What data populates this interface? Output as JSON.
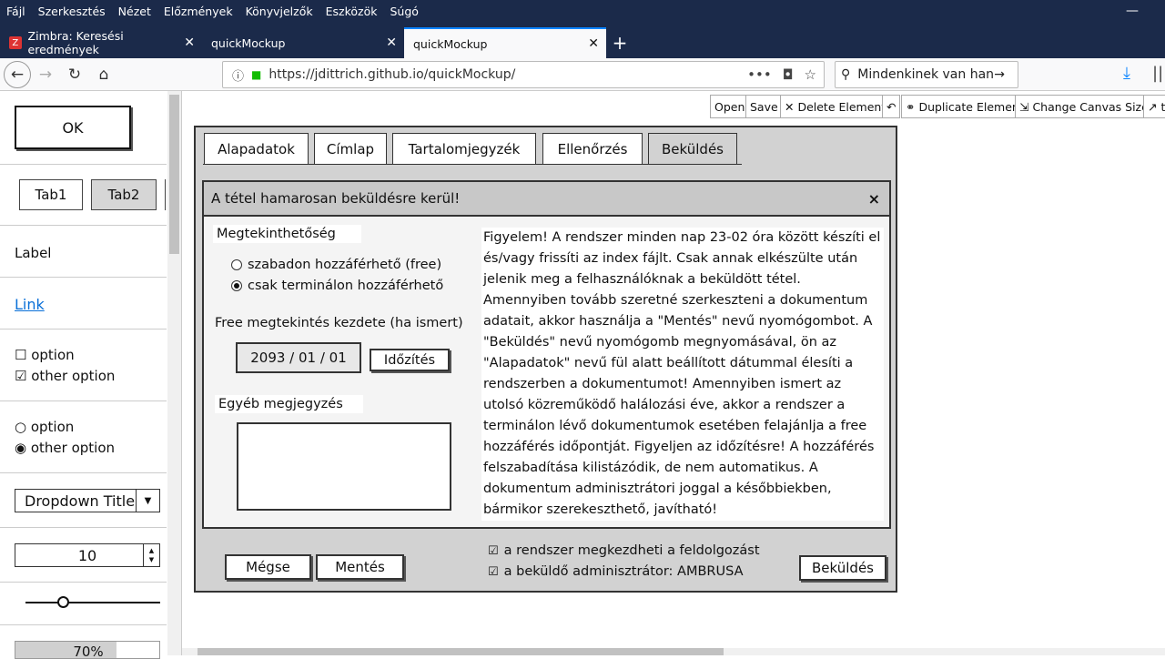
{
  "menubar": {
    "items": [
      "Fájl",
      "Szerkesztés",
      "Nézet",
      "Előzmények",
      "Könyvjelzők",
      "Eszközök",
      "Súgó"
    ],
    "minimize": "—"
  },
  "browser_tabs": [
    {
      "label": "Zimbra: Keresési eredmények",
      "favicon": "Z"
    },
    {
      "label": "quickMockup"
    },
    {
      "label": "quickMockup"
    }
  ],
  "new_tab": "+",
  "nav": {
    "back": "←",
    "forward": "→",
    "reload": "↻",
    "home": "⌂",
    "info": "ⓘ",
    "lock": "🔒",
    "url": "https://jdittrich.github.io/quickMockup/",
    "more": "•••",
    "pocket": "◘",
    "star": "☆",
    "search_icon": "⚲",
    "search_value": "Mindenkinek van hangj",
    "search_go": "→",
    "download": "⤓",
    "library": "|||\\"
  },
  "sidebar": {
    "ok_button": "OK",
    "tab1": "Tab1",
    "tab2": "Tab2",
    "label": "Label",
    "link": "Link",
    "checkbox1": "☐ option",
    "checkbox2": "☑ other option",
    "radio1": "○ option",
    "radio2": "◉ other option",
    "dropdown": "Dropdown Title",
    "dropdown_arrow": "▼",
    "spinner_value": "10",
    "spin_up": "▲",
    "spin_down": "▼",
    "slider_value": 0.28,
    "progress": "70%",
    "progress_value": 0.7
  },
  "toolbar": {
    "open": "Open",
    "save": "Save",
    "delete": "✕ Delete Element",
    "undo": "↶",
    "duplicate": "⚭ Duplicate Element",
    "canvas_size": "⇲ Change Canvas Size",
    "more": "↗ t"
  },
  "wizard": {
    "tabs": [
      "Alapadatok",
      "Címlap",
      "Tartalomjegyzék",
      "Ellenőrzés",
      "Beküldés"
    ],
    "dialog_title": "A tétel hamarosan beküldésre kerül!",
    "close": "×",
    "visibility_title": "Megtekinthetőség",
    "radio_free": "szabadon hozzáférhető (free)",
    "radio_terminal": "csak terminálon hozzáférhető",
    "free_start_label": "Free megtekintés kezdete (ha ismert)",
    "date_value": "2093 / 01 / 01",
    "schedule_button": "Időzítés",
    "notes_label": "Egyéb megjegyzés",
    "paragraph": "Figyelem! A rendszer minden nap 23-02 óra között készíti el és/vagy frissíti az index fájlt. Csak annak elkészülte után jelenik meg a felhasználóknak a beküldött tétel. Amennyiben tovább szeretné szerkeszteni a dokumentum adatait, akkor használja a \"Mentés\" nevű nyomógombot. A \"Beküldés\" nevű nyomógomb megnyomásával, ön az \"Alapadatok\" nevű fül alatt beállított dátummal élesíti a rendszerben a dokumentumot! Amennyiben ismert az utolsó közreműködő halálozási éve, akkor a rendszer a terminálon lévő dokumentumok esetében felajánlja a free hozzáférés időpontját. Figyeljen az időzítésre! A hozzáférés felszabadítása kilistázódik, de nem automatikus. A dokumentum adminisztrátori joggal a későbbiekben, bármikor szerekeszthető, javítható!",
    "cancel": "Mégse",
    "save": "Mentés",
    "check1": "a rendszer megkezdheti a feldolgozást",
    "check2": "a beküldő adminisztrátor: AMBRUSA",
    "check_mark": "☑",
    "submit": "Beküldés"
  }
}
